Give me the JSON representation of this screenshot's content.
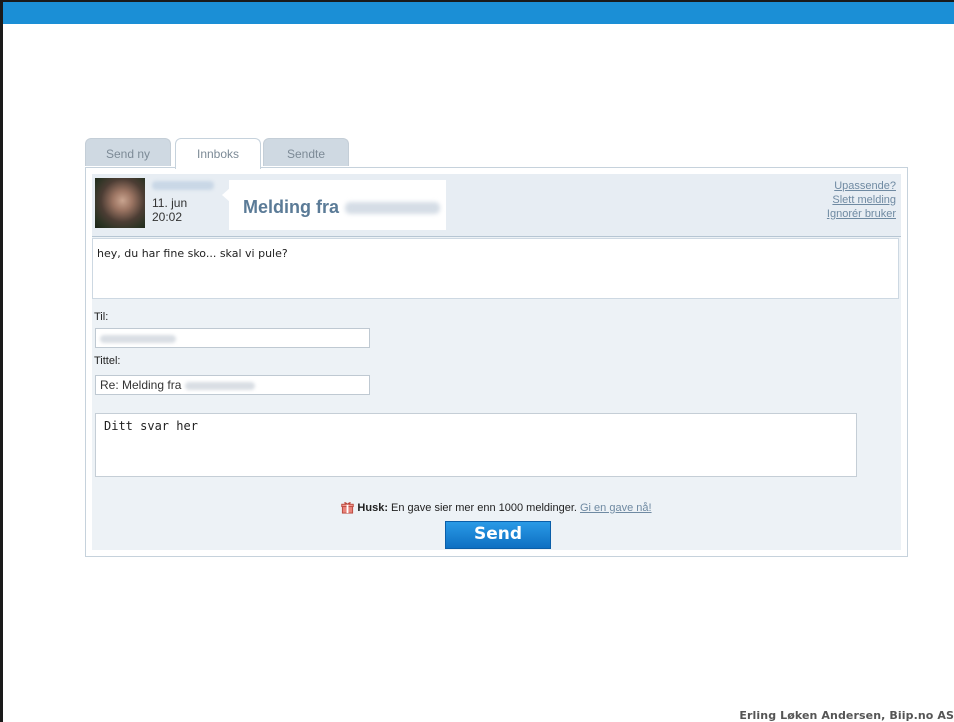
{
  "tabs": [
    {
      "label": "Send ny",
      "active": false
    },
    {
      "label": "Innboks",
      "active": true
    },
    {
      "label": "Sendte",
      "active": false
    }
  ],
  "message": {
    "date": "11. jun",
    "time": "20:02",
    "title_prefix": "Melding fra",
    "body": "hey, du har fine sko... skal vi pule?"
  },
  "actions": {
    "report": "Upassende?",
    "delete": "Slett melding",
    "ignore": "Ignorér bruker"
  },
  "form": {
    "to_label": "Til:",
    "title_label": "Tittel:",
    "title_prefix": "Re: Melding fra",
    "reply_placeholder": "Ditt svar her"
  },
  "reminder": {
    "bold": "Husk:",
    "text": " En gave sier mer enn 1000 meldinger. ",
    "link": "Gi en gave nå!"
  },
  "send_label": "Send",
  "footer_credit": "Erling Løken Andersen, Biip.no AS",
  "colors": {
    "top_bar": "#1b8fd6",
    "send_button": "#1a82d4",
    "link": "#6f8aa2",
    "title": "#5b7b97"
  }
}
